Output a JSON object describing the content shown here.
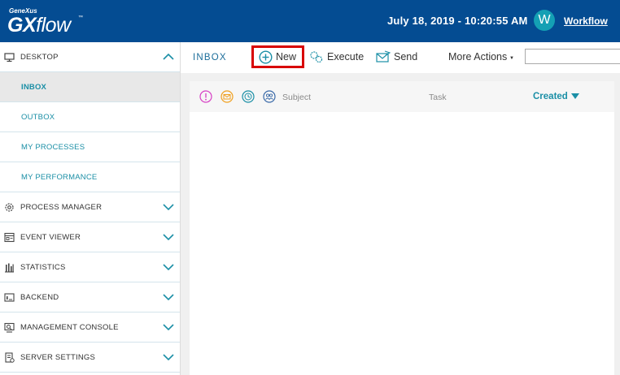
{
  "header": {
    "logo_top": "GeneXus",
    "logo_main_a": "GX",
    "logo_main_b": "flow",
    "logo_tm": "™",
    "datetime": "July 18, 2019 - 10:20:55 AM",
    "avatar_letter": "W",
    "user_link": "Workflow"
  },
  "sidebar": {
    "desktop": "DESKTOP",
    "sub_items": [
      "INBOX",
      "OUTBOX",
      "MY PROCESSES",
      "MY PERFORMANCE"
    ],
    "sections": [
      {
        "label": "PROCESS MANAGER",
        "icon": "gear-icon"
      },
      {
        "label": "EVENT VIEWER",
        "icon": "event-viewer-icon"
      },
      {
        "label": "STATISTICS",
        "icon": "bar-chart-icon"
      },
      {
        "label": "BACKEND",
        "icon": "backend-icon"
      },
      {
        "label": "MANAGEMENT CONSOLE",
        "icon": "console-icon"
      },
      {
        "label": "SERVER SETTINGS",
        "icon": "server-settings-icon"
      }
    ]
  },
  "toolbar": {
    "title": "INBOX",
    "new_label": "New",
    "execute_label": "Execute",
    "send_label": "Send",
    "more_actions_label": "More Actions",
    "more_caret": "▼",
    "search_value": ""
  },
  "grid": {
    "columns": {
      "subject": "Subject",
      "task": "Task",
      "created": "Created"
    },
    "rows": []
  },
  "colors": {
    "header_bg": "#044c92",
    "accent": "#1b8fa6",
    "highlight": "#d80000",
    "avatar": "#14a0b4"
  }
}
